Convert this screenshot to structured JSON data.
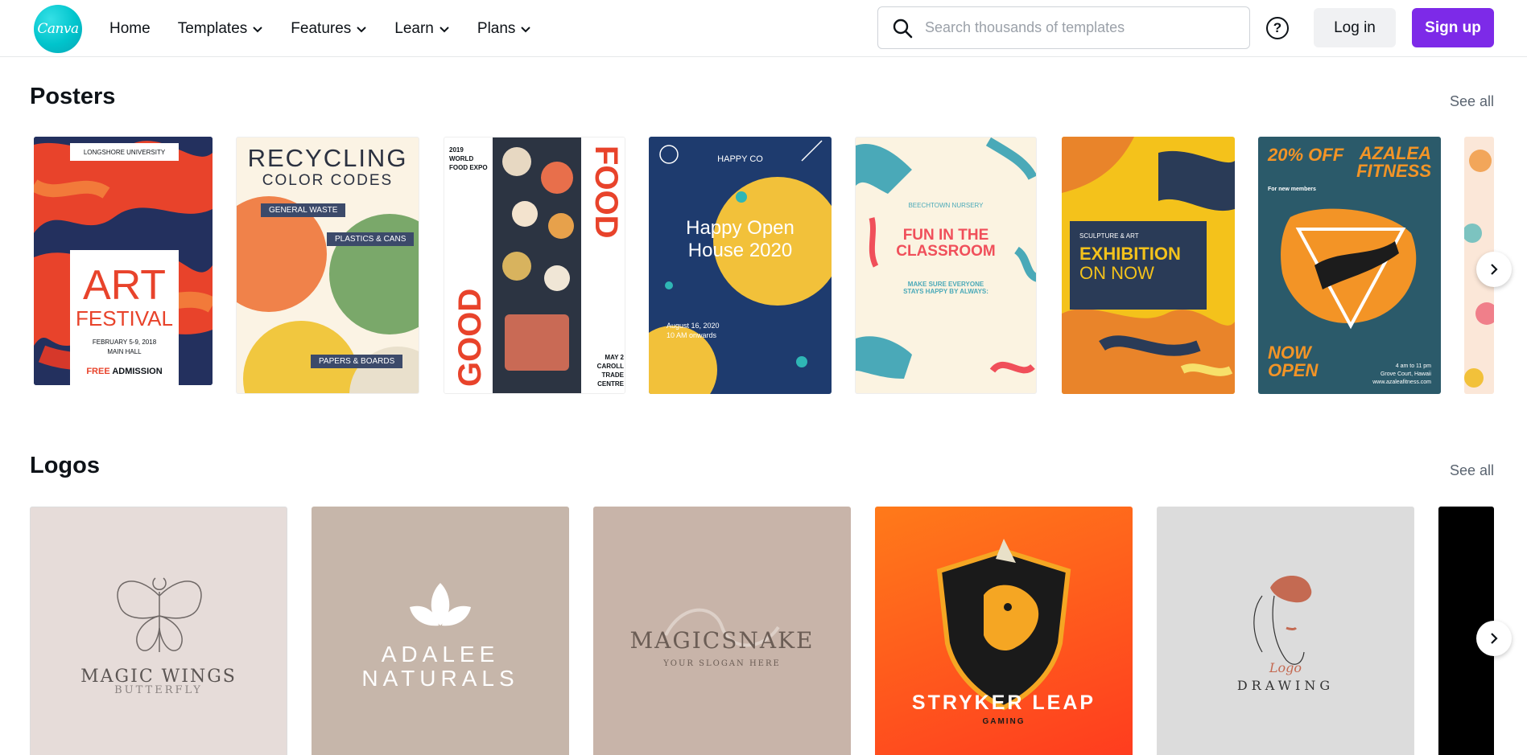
{
  "header": {
    "logo_text": "Canva",
    "nav": [
      {
        "label": "Home",
        "has_menu": false
      },
      {
        "label": "Templates",
        "has_menu": true
      },
      {
        "label": "Features",
        "has_menu": true
      },
      {
        "label": "Learn",
        "has_menu": true
      },
      {
        "label": "Plans",
        "has_menu": true
      }
    ],
    "search_placeholder": "Search thousands of templates",
    "help_label": "?",
    "login_label": "Log in",
    "signup_label": "Sign up"
  },
  "colors": {
    "brand": "#00c4cc",
    "accent_purple": "#7d2ae8"
  },
  "posters": {
    "title": "Posters",
    "see_all": "See all",
    "cards": [
      {
        "name": "art-festival",
        "top": "LONGSHORE UNIVERSITY",
        "title1": "ART",
        "title2": "FESTIVAL",
        "date": "FEBRUARY 5-9, 2018",
        "venue": "MAIN HALL",
        "free": "FREE",
        "admission": "ADMISSION"
      },
      {
        "name": "recycling",
        "title1": "RECYCLING",
        "title2": "COLOR CODES",
        "tag1": "GENERAL WASTE",
        "tag2": "PLASTICS & CANS",
        "tag3": "PAPERS & BOARDS"
      },
      {
        "name": "good-food",
        "left_top": "2019 WORLD FOOD EXPO",
        "word1": "FOOD",
        "word2": "GOOD",
        "right_bottom": "MAY 2 CAROLL TRADE CENTRE"
      },
      {
        "name": "open-house",
        "brand": "HAPPY CO",
        "title": "Happy Open House 2020",
        "date": "August 16, 2020",
        "time": "10 AM onwards"
      },
      {
        "name": "classroom",
        "top": "BEECHTOWN NURSERY",
        "title": "FUN IN THE CLASSROOM",
        "sub": "MAKE SURE EVERYONE STAYS HAPPY BY ALWAYS:"
      },
      {
        "name": "exhibition",
        "top": "SCULPTURE & ART",
        "title1": "EXHIBITION",
        "title2": "ON NOW"
      },
      {
        "name": "azalea",
        "offer": "20% OFF",
        "offer_sub": "For new members",
        "brand": "AZALEA FITNESS",
        "cta": "NOW OPEN",
        "hours": "4 am to 11 pm",
        "address": "Grove Court, Hawaii",
        "web": "www.azaleafitness.com"
      }
    ]
  },
  "logos": {
    "title": "Logos",
    "see_all": "See all",
    "cards": [
      {
        "name": "magic-wings",
        "title": "MAGIC WINGS",
        "sub": "BUTTERFLY"
      },
      {
        "name": "adalee",
        "title1": "ADALEE",
        "title2": "NATURALS"
      },
      {
        "name": "magicsnake",
        "title": "MAGICSNAKE",
        "sub": "YOUR SLOGAN HERE"
      },
      {
        "name": "stryker",
        "title": "STRYKER LEAP",
        "sub": "GAMING"
      },
      {
        "name": "drawing",
        "script": "Logo",
        "title": "DRAWING"
      }
    ]
  }
}
